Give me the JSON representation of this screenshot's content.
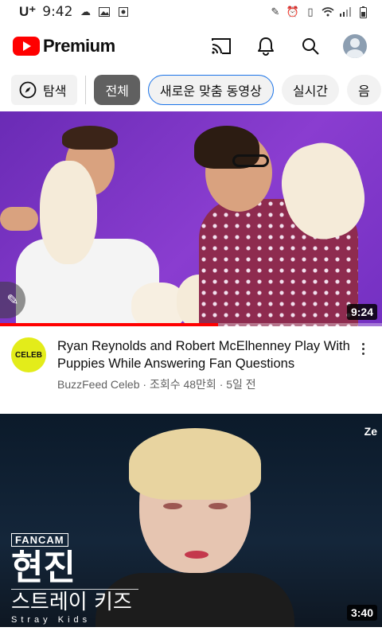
{
  "status_bar": {
    "carrier": "U⁺",
    "time": "9:42"
  },
  "header": {
    "logo_text": "Premium"
  },
  "chips": [
    {
      "label": "탐색"
    },
    {
      "label": "전체"
    },
    {
      "label": "새로운 맞춤 동영상"
    },
    {
      "label": "실시간"
    },
    {
      "label": "음"
    }
  ],
  "videos": [
    {
      "title": "Ryan Reynolds and Robert McElhenney Play With Puppies While Answering Fan Questions",
      "channel": "BuzzFeed Celeb",
      "views": "조회수 48만회",
      "age": "5일 전",
      "subtitle": "BuzzFeed Celeb · 조회수 48만회 · 5일 전",
      "duration": "9:24",
      "watched_fraction": 0.57,
      "channel_avatar_text": "CELEB"
    },
    {
      "duration": "3:40",
      "overlay": {
        "badge": "FANCAM",
        "name": "현진",
        "group": "스트레이 키즈",
        "group_en": "Stray Kids",
        "corner": "Ze"
      }
    }
  ],
  "colors": {
    "brand_red": "#ff0000",
    "chip_active": "#606060",
    "chip_outline": "#1a73e8"
  }
}
